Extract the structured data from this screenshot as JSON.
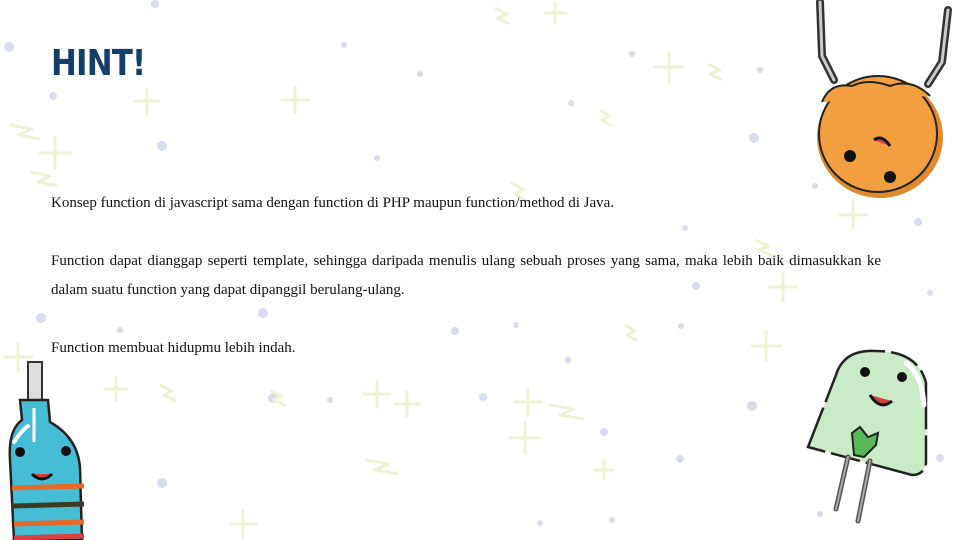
{
  "slide": {
    "title": "HINT!",
    "paragraphs": [
      "Konsep function di javascript sama dengan function di PHP maupun function/method di Java.",
      "Function dapat dianggap seperti template, sehingga daripada menulis ulang sebuah proses yang sama, maka lebih baik dimasukkan ke dalam suatu function yang dapat dipanggil berulang-ulang.",
      "Function membuat hidupmu lebih indah."
    ]
  },
  "colors": {
    "title": "#143f6b",
    "capacitor_body": "#f29f3f",
    "led_body": "#c9ebc7",
    "led_chip": "#5bb85a",
    "bottle_body": "#45bdd5",
    "background_dots": "#d9dcee",
    "background_plus": "#eef3d6"
  },
  "decorations": [
    "capacitor-character",
    "led-character",
    "bottle-character",
    "background-confetti"
  ]
}
